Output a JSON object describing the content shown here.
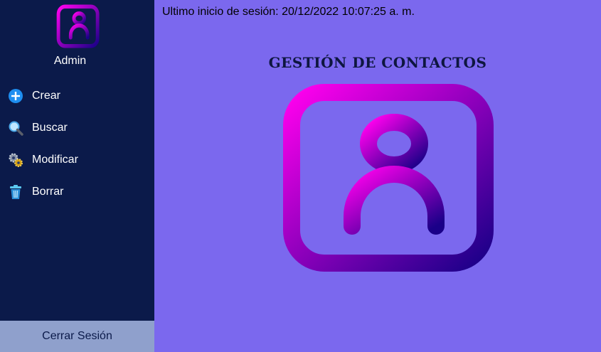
{
  "sidebar": {
    "user_label": "Admin",
    "logo_icon": "contact-book-icon",
    "items": [
      {
        "label": "Crear",
        "icon": "plus-circle-icon"
      },
      {
        "label": "Buscar",
        "icon": "magnifier-icon"
      },
      {
        "label": "Modificar",
        "icon": "gears-icon"
      },
      {
        "label": "Borrar",
        "icon": "trash-icon"
      }
    ],
    "logout_label": "Cerrar Sesión"
  },
  "main": {
    "last_login": "Ultimo inicio de sesión: 20/12/2022 10:07:25 a. m.",
    "title": "GESTIÓN DE CONTACTOS",
    "hero_icon": "contact-book-icon"
  },
  "colors": {
    "sidebar_bg": "#0b1a4a",
    "main_bg": "#7b68ee",
    "logout_bg": "#8fa0cc",
    "gradient_start": "#ff00ee",
    "gradient_end": "#1a0088"
  }
}
